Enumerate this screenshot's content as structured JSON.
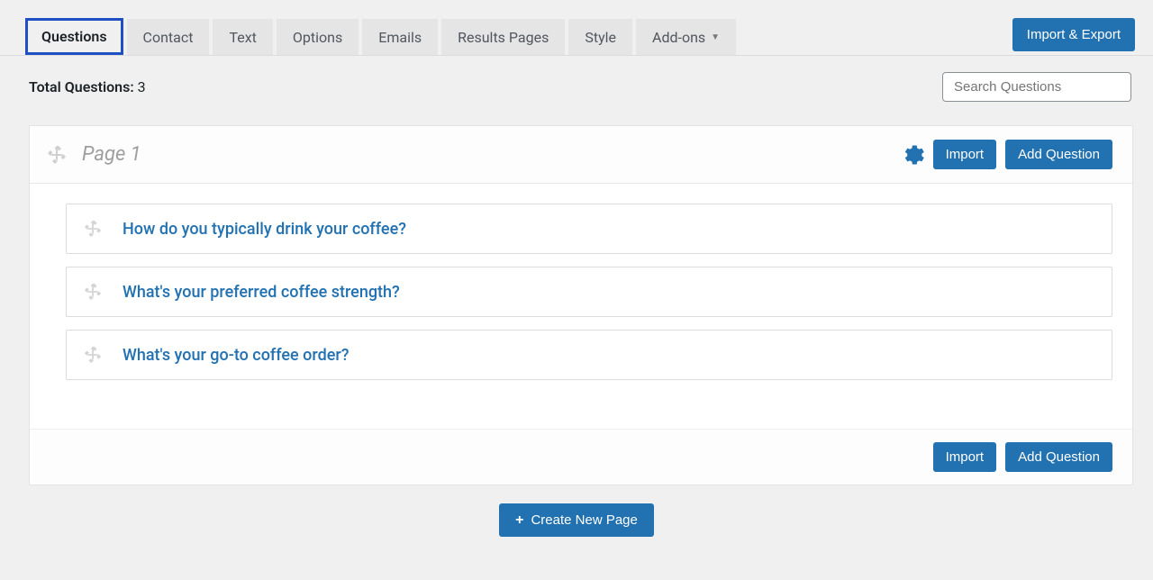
{
  "tabs": [
    {
      "label": "Questions"
    },
    {
      "label": "Contact"
    },
    {
      "label": "Text"
    },
    {
      "label": "Options"
    },
    {
      "label": "Emails"
    },
    {
      "label": "Results Pages"
    },
    {
      "label": "Style"
    },
    {
      "label": "Add-ons",
      "hasDropdown": true
    }
  ],
  "active_tab_index": 0,
  "import_export_label": "Import & Export",
  "total_questions": {
    "label": "Total Questions:",
    "value": "3"
  },
  "search": {
    "placeholder": "Search Questions"
  },
  "page": {
    "title": "Page 1",
    "import_label": "Import",
    "add_question_label": "Add Question",
    "questions": [
      {
        "title": "How do you typically drink your coffee?"
      },
      {
        "title": "What's your preferred coffee strength?"
      },
      {
        "title": "What's your go-to coffee order?"
      }
    ]
  },
  "footer": {
    "import_label": "Import",
    "add_question_label": "Add Question"
  },
  "create_new_page_label": "Create New Page"
}
